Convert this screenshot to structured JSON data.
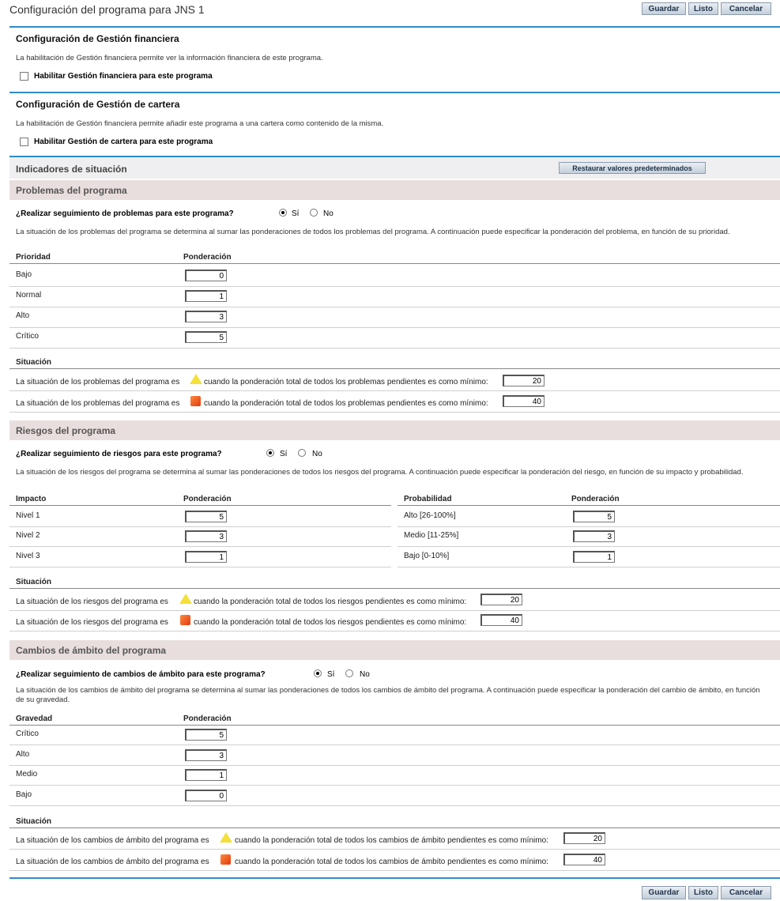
{
  "header": {
    "title": "Configuración del programa para JNS 1",
    "save": "Guardar",
    "done": "Listo",
    "cancel": "Cancelar"
  },
  "financial": {
    "title": "Configuración de Gestión financiera",
    "desc": "La habilitación de Gestión financiera permite ver la información financiera de este programa.",
    "checkbox_label": "Habilitar Gestión financiera para este programa"
  },
  "portfolio": {
    "title": "Configuración de Gestión de cartera",
    "desc": "La habilitación de Gestión financiera permite añadir este programa a una cartera como contenido de la misma.",
    "checkbox_label": "Habilitar Gestión de cartera para este programa"
  },
  "indicators": {
    "title": "Indicadores de situación",
    "restore": "Restaurar valores predeterminados"
  },
  "issues": {
    "title": "Problemas del programa",
    "question": "¿Realizar seguimiento de problemas para este programa?",
    "yes": "Sí",
    "no": "No",
    "desc": "La situación de los problemas del programa se determina al sumar las ponderaciones de todos los problemas del programa. A continuación puede especificar la ponderación del problema, en función de su prioridad.",
    "col_priority": "Prioridad",
    "col_weight": "Ponderación",
    "rows": [
      {
        "label": "Bajo",
        "value": "0"
      },
      {
        "label": "Normal",
        "value": "1"
      },
      {
        "label": "Alto",
        "value": "3"
      },
      {
        "label": "Crítico",
        "value": "5"
      }
    ],
    "status_title": "Situación",
    "status_prefix": "La situación de los problemas del programa es",
    "status_suffix": "cuando la ponderación total de todos los problemas pendientes es como mínimo:",
    "yellow_value": "20",
    "red_value": "40"
  },
  "risks": {
    "title": "Riesgos del programa",
    "question": "¿Realizar seguimiento de riesgos para este programa?",
    "yes": "Sí",
    "no": "No",
    "desc": "La situación de los riesgos del programa se determina al sumar las ponderaciones de todos los riesgos del programa. A continuación puede especificar la ponderación del riesgo, en función de su impacto y probabilidad.",
    "col_impact": "Impacto",
    "col_weight": "Ponderación",
    "col_probability": "Probabilidad",
    "impact_rows": [
      {
        "label": "Nivel 1",
        "value": "5"
      },
      {
        "label": "Nivel 2",
        "value": "3"
      },
      {
        "label": "Nivel 3",
        "value": "1"
      }
    ],
    "probability_rows": [
      {
        "label": "Alto [26-100%]",
        "value": "5"
      },
      {
        "label": "Medio [11-25%]",
        "value": "3"
      },
      {
        "label": "Bajo [0-10%]",
        "value": "1"
      }
    ],
    "status_title": "Situación",
    "status_prefix": "La situación de los riesgos del programa es",
    "status_suffix": "cuando la ponderación total de todos los riesgos pendientes es como mínimo:",
    "yellow_value": "20",
    "red_value": "40"
  },
  "scope": {
    "title": "Cambios de ámbito del programa",
    "question": "¿Realizar seguimiento de cambios de ámbito para este programa?",
    "yes": "Sí",
    "no": "No",
    "desc": "La situación de los cambios de ámbito del programa se determina al sumar las ponderaciones de todos los cambios de ámbito del programa. A continuación puede especificar la ponderación del cambio de ámbito, en función de su gravedad.",
    "col_severity": "Gravedad",
    "col_weight": "Ponderación",
    "rows": [
      {
        "label": "Crítico",
        "value": "5"
      },
      {
        "label": "Alto",
        "value": "3"
      },
      {
        "label": "Medio",
        "value": "1"
      },
      {
        "label": "Bajo",
        "value": "0"
      }
    ],
    "status_title": "Situación",
    "status_prefix": "La situación de los cambios de ámbito del programa es",
    "status_suffix": "cuando la ponderación total de todos los cambios de ámbito pendientes es como mínimo:",
    "yellow_value": "20",
    "red_value": "40"
  },
  "footer": {
    "save": "Guardar",
    "done": "Listo",
    "cancel": "Cancelar"
  },
  "colors": {
    "accent_blue": "#2f8bc9",
    "warning_yellow": "#f3e03a",
    "alert_red": "#e23a10"
  }
}
